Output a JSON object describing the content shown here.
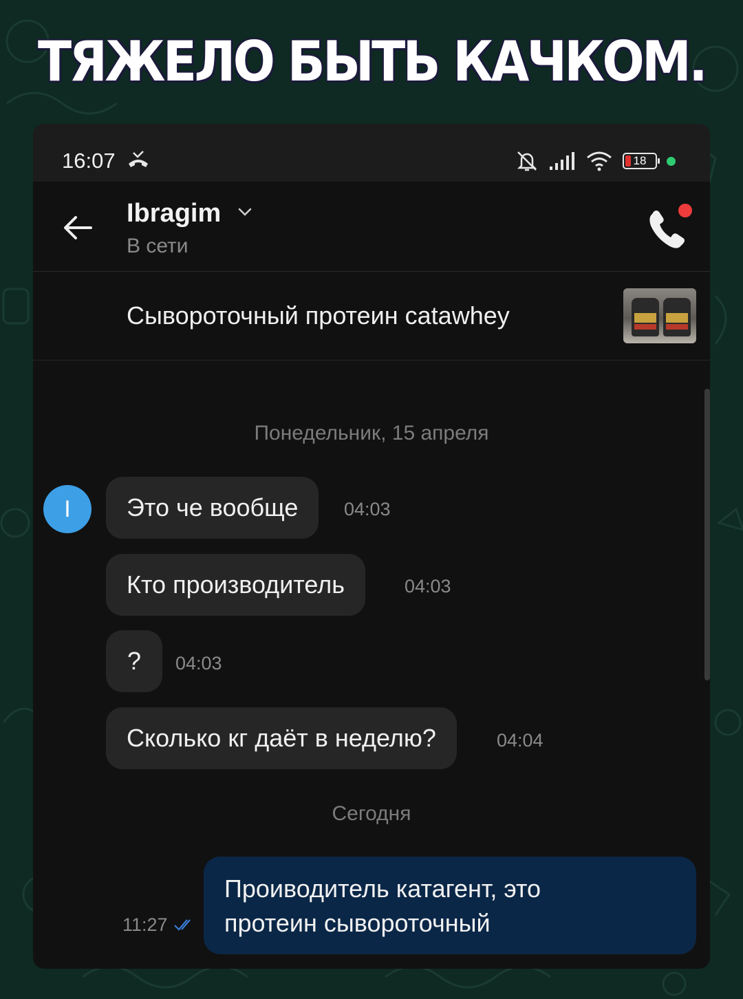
{
  "meme_title": "ТЯЖЕЛО БЫТЬ КАЧКОМ.",
  "status_bar": {
    "time": "16:07",
    "battery_level": "18",
    "icons": [
      "missed-call-icon",
      "mute-icon",
      "signal-icon",
      "wifi-icon",
      "battery-icon",
      "status-dot-icon"
    ]
  },
  "header": {
    "contact_name": "Ibragim",
    "status": "В сети"
  },
  "product": {
    "title": "Сывороточный протеин catawhey"
  },
  "chat": {
    "date_separator_1": "Понедельник, 15 апреля",
    "avatar_initial": "I",
    "incoming": [
      {
        "text": "Это че вообще",
        "time": "04:03"
      },
      {
        "text": "Кто производитель",
        "time": "04:03"
      },
      {
        "text": "?",
        "time": "04:03"
      },
      {
        "text": "Сколько кг даёт в неделю?",
        "time": "04:04"
      }
    ],
    "date_separator_2": "Сегодня",
    "outgoing": {
      "line1": "Проиводитель катагент, это",
      "line2": "протеин сывороточный",
      "time": "11:27"
    }
  },
  "colors": {
    "background": "#0f2a22",
    "phone": "#111111",
    "incoming_bubble": "#262626",
    "outgoing_bubble": "#0b2747",
    "avatar": "#3d9fe6",
    "read_ticks": "#3a7bd5",
    "online_dot": "#2ecc71",
    "call_badge": "#ee3b3b"
  }
}
